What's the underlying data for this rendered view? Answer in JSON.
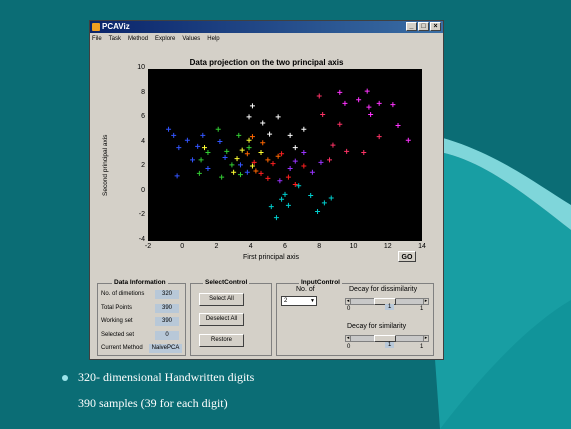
{
  "window": {
    "title": "PCAViz",
    "menu": [
      "File",
      "Task",
      "Method",
      "Explore",
      "Values",
      "Help"
    ],
    "controls": {
      "minimize": "_",
      "maximize": "□",
      "close": "×"
    }
  },
  "plot": {
    "title": "Data projection on the two principal axis",
    "xlabel": "First principal axis",
    "ylabel": "Second principal axis",
    "xticks": [
      "-2",
      "0",
      "2",
      "4",
      "6",
      "8",
      "10",
      "12",
      "14"
    ],
    "yticks": [
      "10",
      "8",
      "6",
      "4",
      "2",
      "0",
      "-2",
      "-4"
    ]
  },
  "chart_data": {
    "type": "scatter",
    "title": "Data projection on the two principal axis",
    "xlabel": "First principal axis",
    "ylabel": "Second principal axis",
    "xlim": [
      -2,
      14
    ],
    "ylim": [
      -4,
      10
    ],
    "marker": "+",
    "series": [
      {
        "color": "#ff33ff",
        "points": [
          [
            9.5,
            7.2
          ],
          [
            10.3,
            7.5
          ],
          [
            11.0,
            6.3
          ],
          [
            11.5,
            7.2
          ],
          [
            10.8,
            8.2
          ],
          [
            12.3,
            7.1
          ],
          [
            12.6,
            5.4
          ],
          [
            13.2,
            4.2
          ],
          [
            9.2,
            8.1
          ],
          [
            10.9,
            6.9
          ]
        ]
      },
      {
        "color": "#ff3366",
        "points": [
          [
            8.2,
            6.3
          ],
          [
            9.2,
            5.5
          ],
          [
            8.8,
            3.8
          ],
          [
            11.5,
            4.5
          ],
          [
            8.0,
            7.8
          ],
          [
            9.6,
            3.3
          ],
          [
            10.6,
            3.2
          ],
          [
            8.6,
            2.6
          ]
        ]
      },
      {
        "color": "#3355ff",
        "points": [
          [
            -0.8,
            5.1
          ],
          [
            0.3,
            4.2
          ],
          [
            -0.2,
            3.6
          ],
          [
            1.2,
            4.6
          ],
          [
            0.6,
            2.6
          ],
          [
            -0.3,
            1.3
          ],
          [
            2.5,
            2.8
          ],
          [
            3.4,
            2.2
          ],
          [
            1.5,
            1.9
          ],
          [
            0.9,
            3.7
          ],
          [
            2.2,
            4.1
          ],
          [
            3.8,
            1.6
          ],
          [
            -0.5,
            4.6
          ]
        ]
      },
      {
        "color": "#00cccc",
        "points": [
          [
            5.2,
            -1.2
          ],
          [
            5.8,
            -0.6
          ],
          [
            6.2,
            -1.1
          ],
          [
            7.5,
            -0.3
          ],
          [
            8.3,
            -0.9
          ],
          [
            6.8,
            0.5
          ],
          [
            5.5,
            -2.1
          ],
          [
            7.9,
            -1.6
          ],
          [
            8.7,
            -0.5
          ],
          [
            6.0,
            -0.2
          ]
        ]
      },
      {
        "color": "#33cc33",
        "points": [
          [
            2.1,
            5.1
          ],
          [
            2.6,
            3.3
          ],
          [
            1.0,
            1.5
          ],
          [
            2.9,
            2.2
          ],
          [
            3.3,
            4.6
          ],
          [
            1.5,
            3.2
          ],
          [
            3.9,
            3.6
          ],
          [
            2.3,
            1.2
          ],
          [
            1.1,
            2.6
          ],
          [
            3.4,
            1.4
          ]
        ]
      },
      {
        "color": "#ffff33",
        "points": [
          [
            3.5,
            3.4
          ],
          [
            4.1,
            2.1
          ],
          [
            3.2,
            2.7
          ],
          [
            1.3,
            3.6
          ],
          [
            3.9,
            4.2
          ],
          [
            3.0,
            1.6
          ],
          [
            4.6,
            3.2
          ]
        ]
      },
      {
        "color": "#ff6600",
        "points": [
          [
            4.1,
            4.5
          ],
          [
            5.0,
            2.6
          ],
          [
            3.8,
            3.1
          ],
          [
            4.3,
            1.7
          ],
          [
            5.6,
            2.9
          ],
          [
            4.7,
            4.0
          ]
        ]
      },
      {
        "color": "#ff2020",
        "points": [
          [
            5.3,
            2.3
          ],
          [
            4.6,
            1.5
          ],
          [
            6.2,
            1.2
          ],
          [
            5.8,
            3.1
          ],
          [
            7.1,
            2.1
          ],
          [
            4.2,
            2.4
          ],
          [
            6.6,
            0.6
          ],
          [
            5.0,
            1.1
          ]
        ]
      },
      {
        "color": "#ffffff",
        "points": [
          [
            4.1,
            7.0
          ],
          [
            4.7,
            5.6
          ],
          [
            5.6,
            6.1
          ],
          [
            5.1,
            4.7
          ],
          [
            6.3,
            4.6
          ],
          [
            7.1,
            5.1
          ],
          [
            3.9,
            6.1
          ],
          [
            6.6,
            3.6
          ]
        ]
      },
      {
        "color": "#9933ff",
        "points": [
          [
            6.6,
            2.5
          ],
          [
            7.6,
            1.6
          ],
          [
            5.7,
            0.9
          ],
          [
            7.1,
            3.2
          ],
          [
            8.1,
            2.4
          ],
          [
            6.3,
            1.9
          ]
        ]
      }
    ]
  },
  "actions": {
    "go": "GO"
  },
  "data_info": {
    "title": "Data Information",
    "rows": [
      {
        "label": "No. of dimetions",
        "value": "320"
      },
      {
        "label": "Total Points",
        "value": "390"
      },
      {
        "label": "Working set",
        "value": "390"
      },
      {
        "label": "Selected set",
        "value": "0"
      },
      {
        "label": "Current Method",
        "value": "NaivePCA"
      }
    ]
  },
  "select_control": {
    "title": "SelectControl",
    "buttons": [
      "Select All",
      "Deselect All",
      "Restore"
    ]
  },
  "input_control": {
    "title": "InputControl",
    "no_of_label": "No. of",
    "no_of_value": "2",
    "dissim_label": "Decay for dissimilarity",
    "sim_label": "Decay for similarity",
    "slider_min": "0",
    "slider_val": "1",
    "slider_max": "1"
  },
  "bullets": [
    "320- dimensional Handwritten digits",
    "390 samples (39 for each digit)"
  ]
}
